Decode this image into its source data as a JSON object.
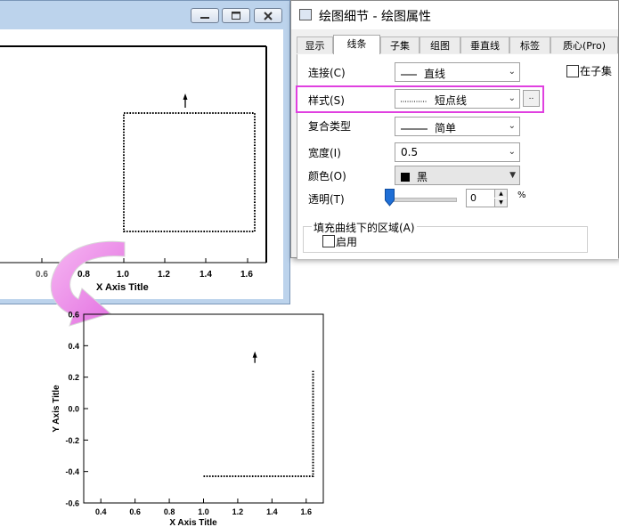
{
  "graph_window": {
    "buttons": {
      "minimize": "minimize",
      "maximize": "maximize",
      "close": "close"
    },
    "x_axis_title": "X Axis Title",
    "x_tick_labels": [
      "0.6",
      "0.8",
      "1.0",
      "1.2",
      "1.4",
      "1.6"
    ]
  },
  "dialog": {
    "title": "绘图细节 - 绘图属性",
    "tabs": [
      "显示",
      "线条",
      "子集",
      "组图",
      "垂直线",
      "标签",
      "质心(Pro)"
    ],
    "active_tab": "线条",
    "fields": {
      "connect_label": "连接(C)",
      "connect_value": "直线",
      "style_label": "样式(S)",
      "style_value": "短点线",
      "more_button": "..",
      "composite_label": "复合类型",
      "composite_value": "简单",
      "width_label": "宽度(I)",
      "width_value": "0.5",
      "color_label": "颜色(O)",
      "color_value": "黑",
      "transparency_label": "透明(T)",
      "transparency_value": "0",
      "transparency_fraction": 0,
      "percent_sign": "%",
      "subset_checkbox": "在子集"
    },
    "fill_group": {
      "title": "填充曲线下的区域(A)",
      "enable_label": "启用",
      "enable_checked": false
    }
  },
  "colors": {
    "highlight": "#e040e0",
    "arrow": "#ee82ee",
    "titlebar": "#bcd3ec",
    "slider_thumb": "#1f6fd6"
  },
  "chart_data": {
    "type": "line",
    "title": "",
    "xlabel": "X Axis Title",
    "ylabel": "Y Axis Title",
    "xlim": [
      0.3,
      1.7
    ],
    "ylim": [
      -0.6,
      0.6
    ],
    "x_ticks": [
      "0.4",
      "0.6",
      "0.8",
      "1.0",
      "1.2",
      "1.4",
      "1.6"
    ],
    "y_ticks": [
      "-0.6",
      "-0.4",
      "-0.2",
      "0.0",
      "0.2",
      "0.4",
      "0.6"
    ],
    "series": [
      {
        "line_style": "short-dot",
        "x": [
          1.0,
          1.64,
          1.64
        ],
        "y": [
          -0.43,
          -0.43,
          0.24
        ]
      }
    ],
    "annotation": {
      "type": "arrow-up",
      "x": 1.3,
      "y": 0.33
    }
  }
}
